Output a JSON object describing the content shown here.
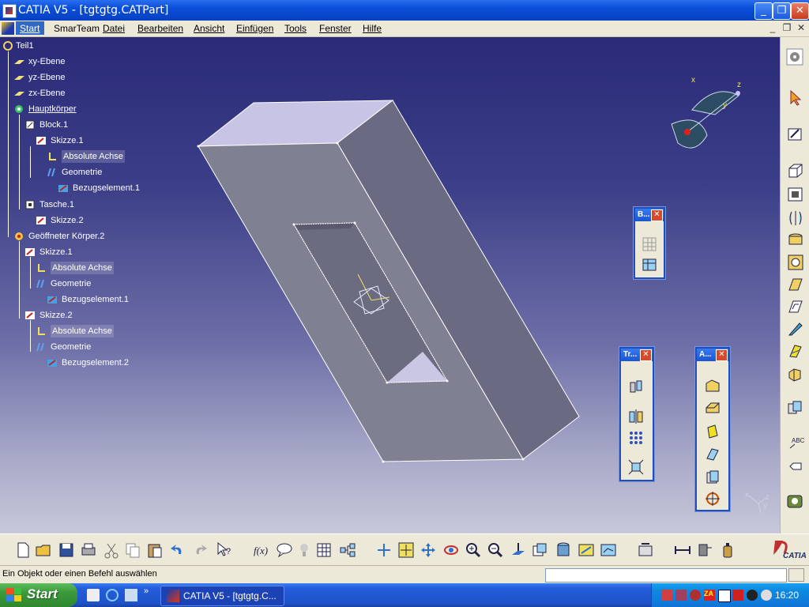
{
  "window": {
    "title": "CATIA V5 - [tgtgtg.CATPart]",
    "controls": [
      "minimize",
      "restore",
      "close"
    ]
  },
  "menu": {
    "items": [
      "Start",
      "SmarTeam",
      "Datei",
      "Bearbeiten",
      "Ansicht",
      "Einfügen",
      "Tools",
      "Fenster",
      "Hilfe"
    ]
  },
  "tree": {
    "root": "Teil1",
    "nodes": [
      {
        "label": "xy-Ebene",
        "icon": "plane-icon"
      },
      {
        "label": "yz-Ebene",
        "icon": "plane-icon"
      },
      {
        "label": "zx-Ebene",
        "icon": "plane-icon"
      },
      {
        "label": "Hauptkörper",
        "icon": "body-icon"
      },
      {
        "label": "Block.1",
        "icon": "pad-icon"
      },
      {
        "label": "Skizze.1",
        "icon": "sketch-icon"
      },
      {
        "label": "Absolute Achse",
        "icon": "axis-icon"
      },
      {
        "label": "Geometrie",
        "icon": "geometry-icon"
      },
      {
        "label": "Bezugselement.1",
        "icon": "datum-icon"
      },
      {
        "label": "Tasche.1",
        "icon": "pocket-icon"
      },
      {
        "label": "Skizze.2",
        "icon": "sketch-icon"
      },
      {
        "label": "Geöffneter Körper.2",
        "icon": "open-body-icon"
      },
      {
        "label": "Skizze.1",
        "icon": "sketch-icon"
      },
      {
        "label": "Absolute Achse",
        "icon": "axis-icon"
      },
      {
        "label": "Geometrie",
        "icon": "geometry-icon"
      },
      {
        "label": "Bezugselement.1",
        "icon": "datum-icon"
      },
      {
        "label": "Skizze.2",
        "icon": "sketch-icon"
      },
      {
        "label": "Absolute Achse",
        "icon": "axis-icon"
      },
      {
        "label": "Geometrie",
        "icon": "geometry-icon"
      },
      {
        "label": "Bezugselement.2",
        "icon": "datum-icon"
      }
    ]
  },
  "compass": {
    "x_label": "x",
    "y_label": "y",
    "z_label": "z"
  },
  "axis_triad": {
    "x_label": "x",
    "y_label": "y",
    "z_label": "z"
  },
  "floating_toolbars": [
    {
      "title": "B..."
    },
    {
      "title": "Tr..."
    },
    {
      "title": "A..."
    }
  ],
  "status": {
    "message": "Ein Objekt oder einen Befehl auswählen",
    "command_value": ""
  },
  "taskbar": {
    "start_label": "Start",
    "task_label": "CATIA V5 - [tgtgtg.C...",
    "clock": "16:20"
  },
  "brand": {
    "logo_text": "CATIA"
  }
}
